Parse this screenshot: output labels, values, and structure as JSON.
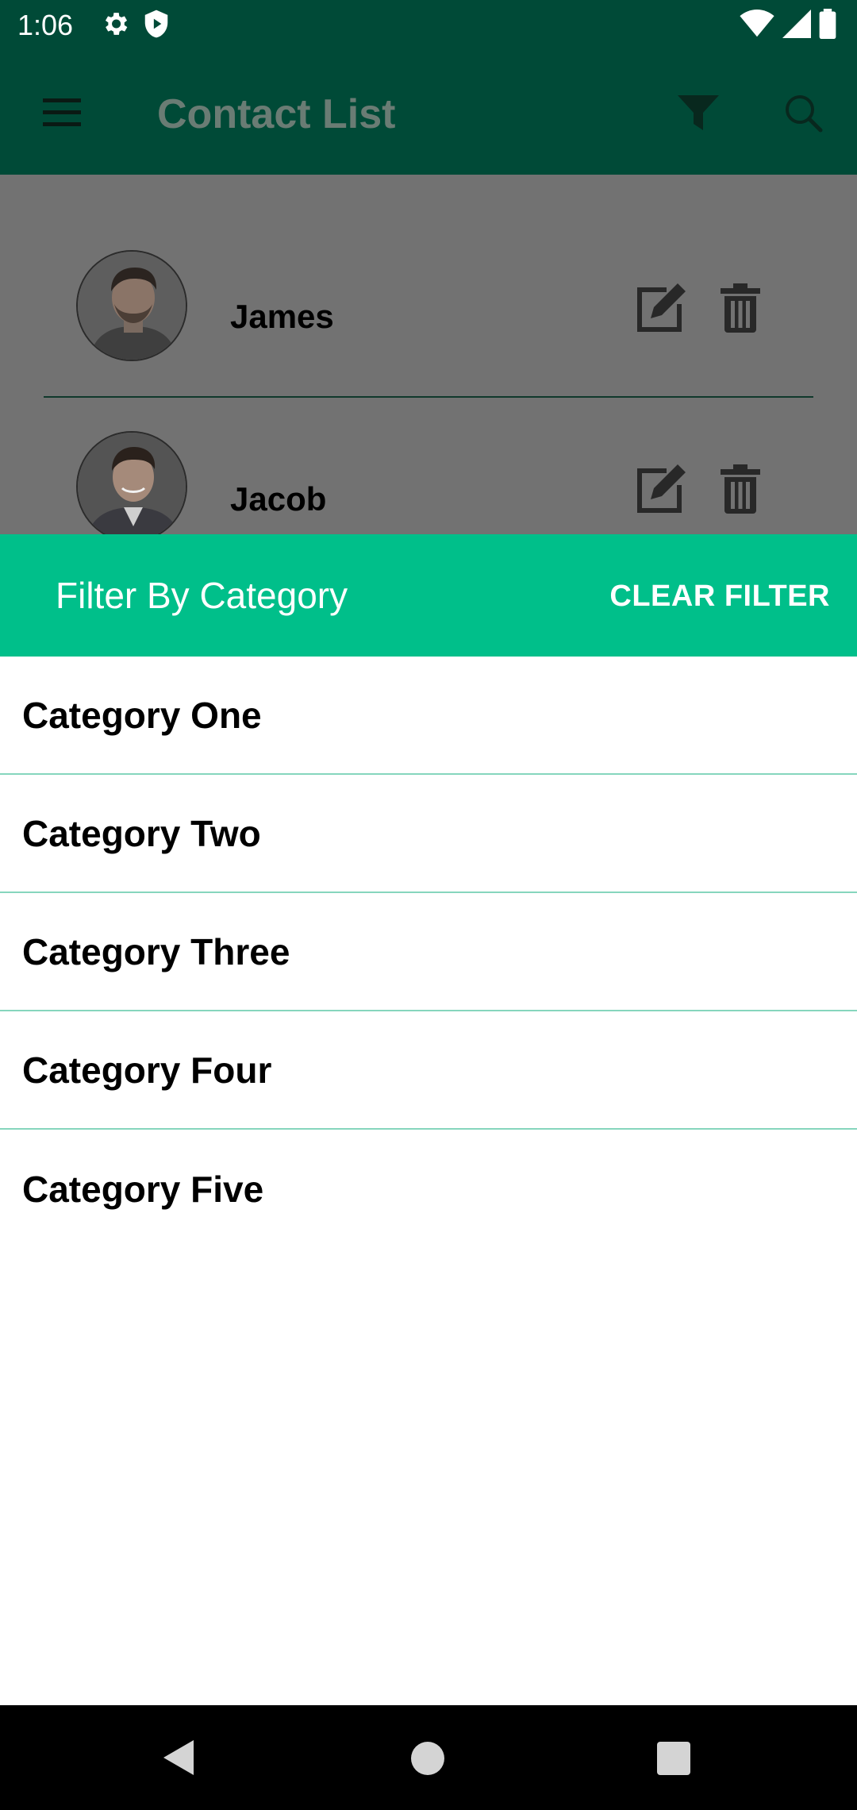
{
  "status_bar": {
    "time": "1:06",
    "icons": [
      "settings-icon",
      "shield-icon",
      "wifi-icon",
      "signal-icon",
      "battery-icon"
    ]
  },
  "app_bar": {
    "title": "Contact List",
    "icons": [
      "menu-icon",
      "filter-icon",
      "search-icon"
    ]
  },
  "contacts": [
    {
      "name": "James"
    },
    {
      "name": "Jacob"
    }
  ],
  "filter_sheet": {
    "title": "Filter By Category",
    "clear_label": "CLEAR FILTER",
    "categories": [
      "Category One",
      "Category Two",
      "Category Three",
      "Category Four",
      "Category Five"
    ]
  },
  "colors": {
    "app_bar": "#004a37",
    "sheet_header": "#00bf8a",
    "divider": "#86d6bd",
    "scrim": "#727272"
  },
  "nav_bar": {
    "icons": [
      "back-icon",
      "home-icon",
      "recents-icon"
    ]
  }
}
